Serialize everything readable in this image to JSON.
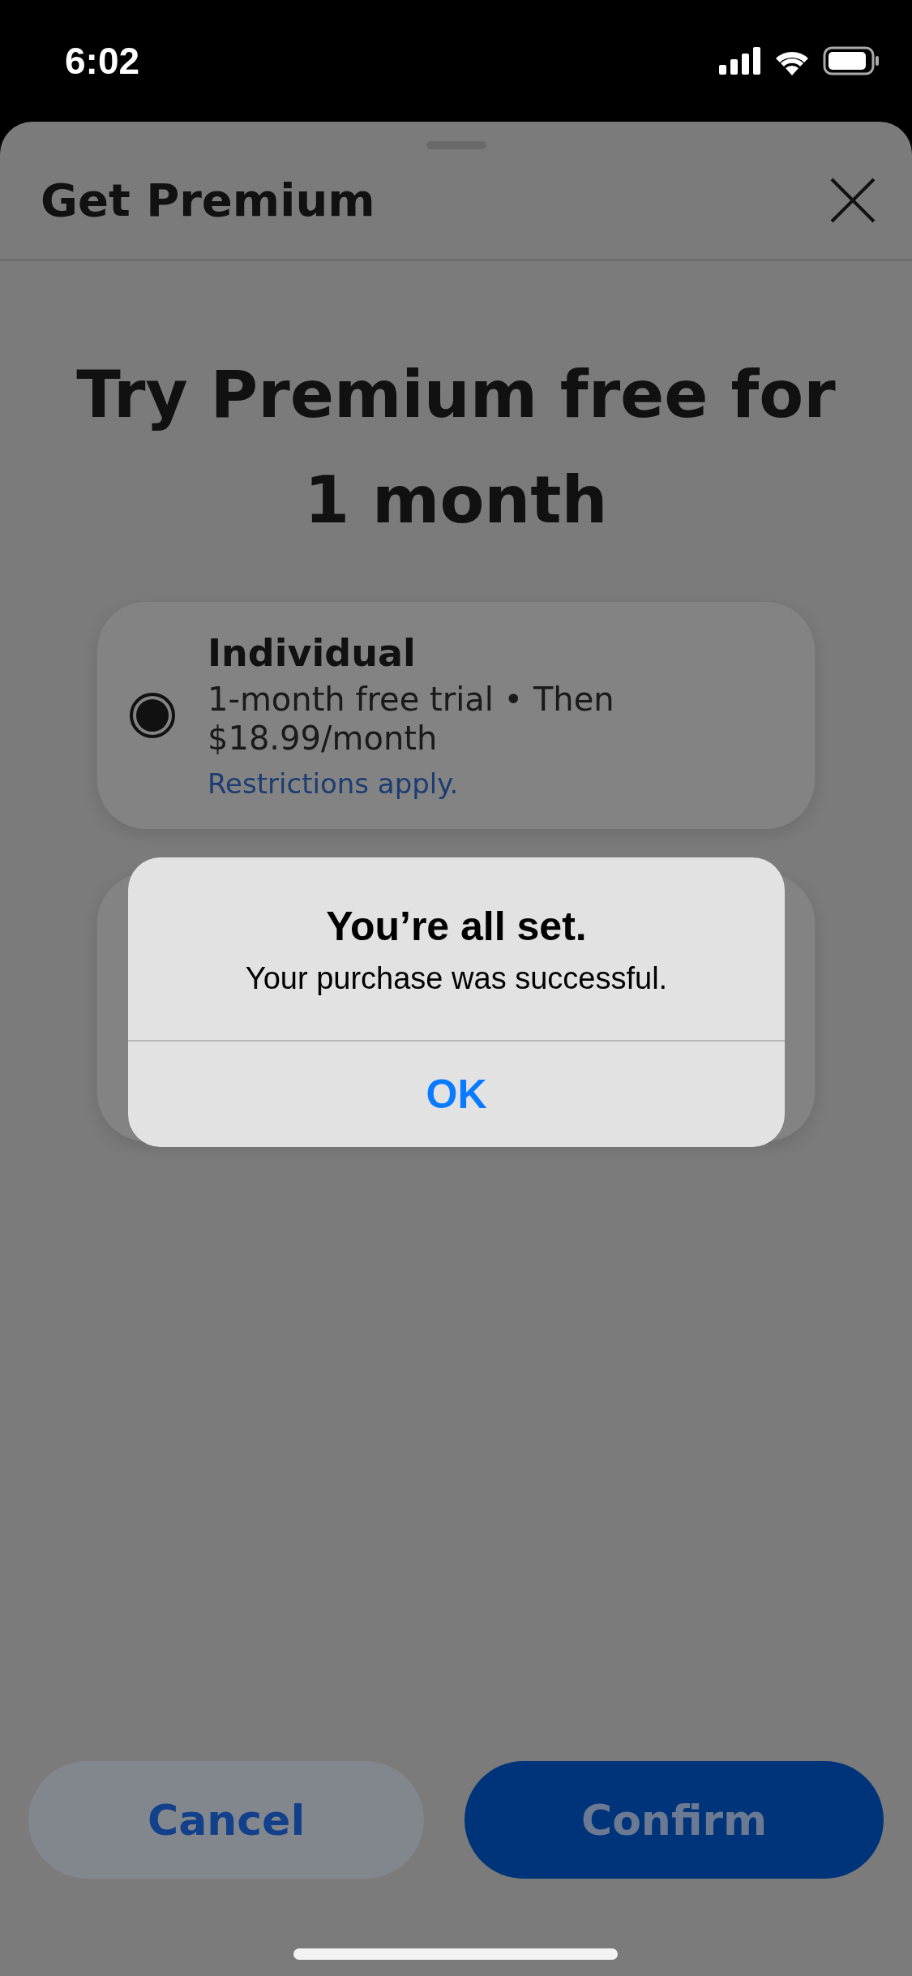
{
  "status_bar": {
    "time": "6:02"
  },
  "sheet": {
    "title": "Get Premium"
  },
  "heading": "Try Premium free for 1 month",
  "plans": [
    {
      "title": "Individual",
      "description": "1-month free trial • Then $18.99/month",
      "link": "Restrictions apply.",
      "selected": true
    }
  ],
  "alert": {
    "title": "You’re all set.",
    "message": "Your purchase was successful.",
    "button": "OK"
  },
  "actions": [
    {
      "label": "Cancel",
      "kind": "secondary"
    },
    {
      "label": "Confirm",
      "kind": "primary"
    }
  ]
}
